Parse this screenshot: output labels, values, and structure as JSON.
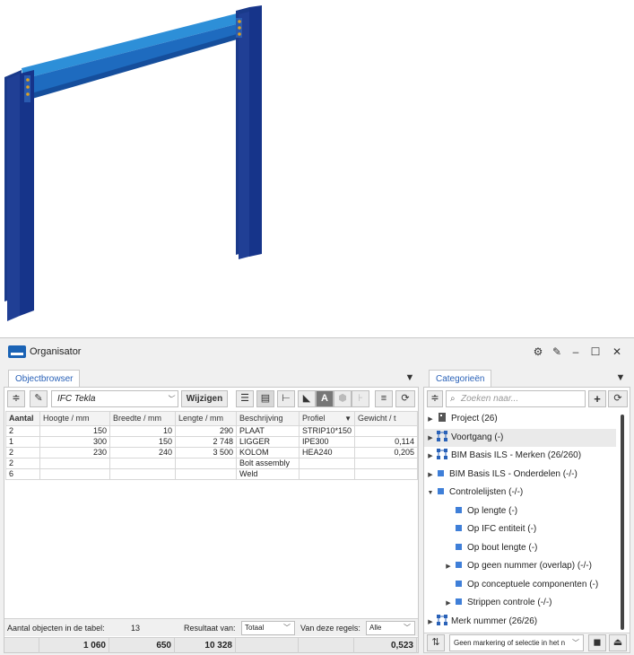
{
  "window": {
    "title": "Organisator"
  },
  "objectbrowser": {
    "tab": "Objectbrowser",
    "filter_value": "IFC Tekla",
    "edit_button": "Wijzigen",
    "columns": [
      "Aantal",
      "Hoogte / mm",
      "Breedte / mm",
      "Lengte / mm",
      "Beschrijving",
      "Profiel",
      "Gewicht / t"
    ],
    "rows": [
      [
        "2",
        "150",
        "10",
        "290",
        "PLAAT",
        "STRIP10*150",
        ""
      ],
      [
        "1",
        "300",
        "150",
        "2 748",
        "LIGGER",
        "IPE300",
        "0,114"
      ],
      [
        "2",
        "230",
        "240",
        "3 500",
        "KOLOM",
        "HEA240",
        "0,205"
      ],
      [
        "2",
        "",
        "",
        "",
        "Bolt assembly",
        "",
        ""
      ],
      [
        "6",
        "",
        "",
        "",
        "Weld",
        "",
        ""
      ]
    ],
    "count_label": "Aantal objecten in de tabel:",
    "count_value": "13",
    "result_label": "Resultaat van:",
    "result_value": "Totaal",
    "rules_label": "Van deze regels:",
    "rules_value": "Alle",
    "totals": [
      "",
      "1 060",
      "650",
      "10 328",
      "",
      "",
      "0,523"
    ]
  },
  "categories": {
    "tab": "Categorieën",
    "search_placeholder": "Zoeken naar...",
    "items": [
      {
        "label": "Project (26)",
        "icon": "building-icon",
        "level": 0,
        "expander": "collapsed"
      },
      {
        "label": "Voortgang (-)",
        "icon": "network-icon",
        "level": 0,
        "expander": "collapsed",
        "selected": true
      },
      {
        "label": "BIM Basis ILS - Merken (26/260)",
        "icon": "network-icon",
        "level": 0,
        "expander": "collapsed"
      },
      {
        "label": "BIM Basis ILS - Onderdelen (-/-)",
        "icon": "square-icon",
        "level": 0,
        "expander": "collapsed"
      },
      {
        "label": "Controlelijsten (-/-)",
        "icon": "square-icon",
        "level": 0,
        "expander": "expanded"
      },
      {
        "label": "Op lengte (-)",
        "icon": "square-icon",
        "level": 1,
        "expander": "none"
      },
      {
        "label": "Op IFC entiteit (-)",
        "icon": "square-icon",
        "level": 1,
        "expander": "none"
      },
      {
        "label": "Op bout lengte (-)",
        "icon": "square-icon",
        "level": 1,
        "expander": "none"
      },
      {
        "label": "Op geen nummer (overlap) (-/-)",
        "icon": "square-icon",
        "level": 1,
        "expander": "collapsed"
      },
      {
        "label": "Op conceptuele componenten (-)",
        "icon": "square-icon",
        "level": 1,
        "expander": "none"
      },
      {
        "label": "Strippen controle (-/-)",
        "icon": "square-icon",
        "level": 1,
        "expander": "collapsed"
      },
      {
        "label": "Merk nummer (26/26)",
        "icon": "network-icon",
        "level": 0,
        "expander": "collapsed"
      }
    ],
    "marking_value": "Geen markering of selectie in het n"
  },
  "colors": {
    "steel": "#1c3a8c",
    "steel_light": "#2d8fd8",
    "accent": "#2a62b8",
    "item_square": "#3f7fd8"
  }
}
